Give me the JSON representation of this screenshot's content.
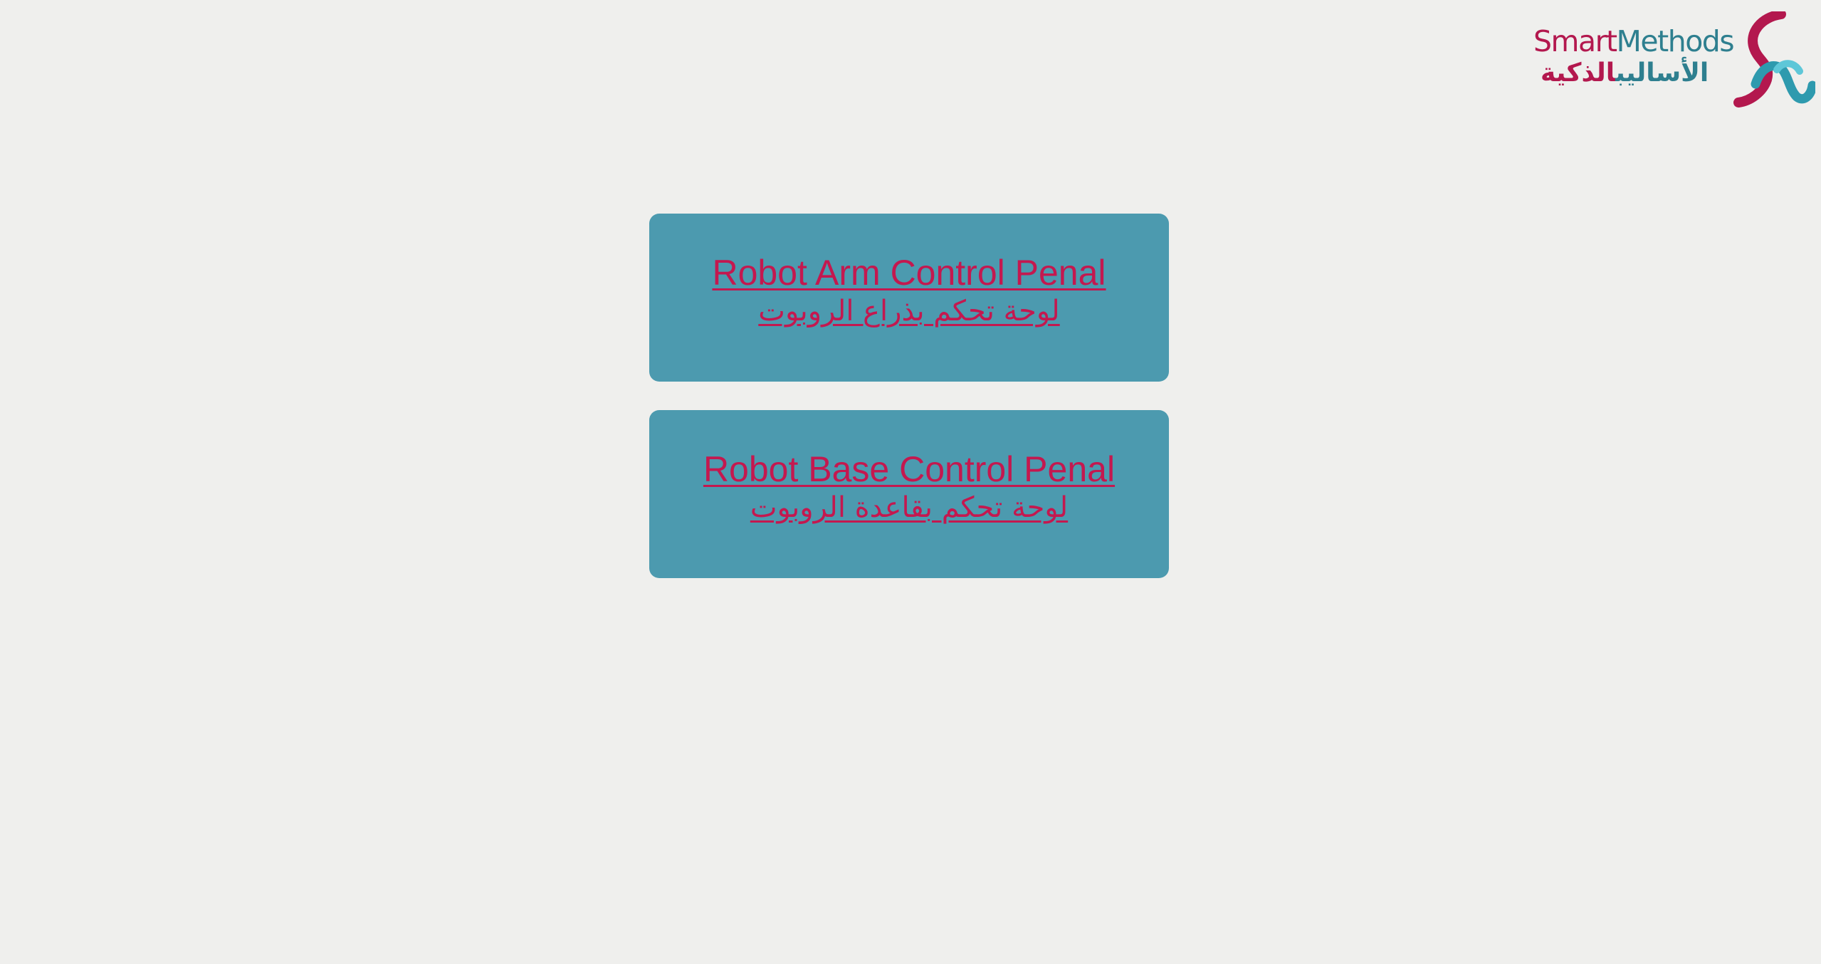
{
  "logo": {
    "text_en_part1": "Smart",
    "text_en_part2": "Methods",
    "text_ar_part1": "الأساليب",
    "text_ar_part2": "الذكية",
    "colors": {
      "primary": "#b3184e",
      "secondary": "#2e7f8f"
    }
  },
  "panels": [
    {
      "label_en": "Robot Arm Control Penal",
      "label_ar": "لوحة تحكم بذراع الروبوت"
    },
    {
      "label_en": "Robot Base Control Penal",
      "label_ar": "لوحة تحكم بقاعدة الروبوت"
    }
  ],
  "colors": {
    "background": "#efefed",
    "panel": "#4c9aaf",
    "link": "#c4184f"
  }
}
